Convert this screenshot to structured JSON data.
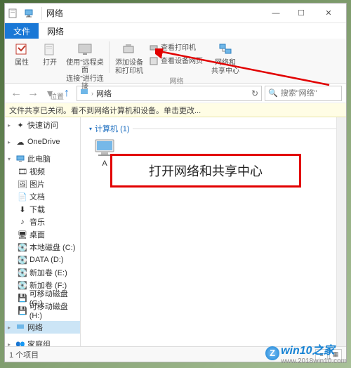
{
  "window": {
    "title": "网络",
    "controls": {
      "min": "—",
      "max": "☐",
      "close": "✕"
    }
  },
  "tabs": {
    "file": "文件",
    "network": "网络"
  },
  "ribbon": {
    "properties": "属性",
    "open": "打开",
    "remote_desc1": "使用\"远程桌面",
    "remote_desc2": "连接\"进行连接",
    "section_location": "位置",
    "add_devices_l1": "添加设备",
    "add_devices_l2": "和打印机",
    "view_printers": "查看打印机",
    "view_devices": "查看设备网页",
    "network_center_l1": "网络和",
    "network_center_l2": "共享中心",
    "section_network": "网络"
  },
  "address": {
    "root_icon": "net",
    "crumb": "网络",
    "search_placeholder": "搜索\"网络\""
  },
  "infobar": "文件共享已关闭。看不到网络计算机和设备。单击更改...",
  "nav": {
    "quick_access": "快速访问",
    "onedrive": "OneDrive",
    "this_pc": "此电脑",
    "videos": "视频",
    "pictures": "图片",
    "documents": "文档",
    "downloads": "下载",
    "music": "音乐",
    "desktop": "桌面",
    "disk_c": "本地磁盘 (C:)",
    "disk_d": "DATA (D:)",
    "disk_e": "新加卷 (E:)",
    "disk_f": "新加卷 (F:)",
    "disk_g": "可移动磁盘 (G:)",
    "disk_h": "可移动磁盘 (H:)",
    "network": "网络",
    "homegroup": "家庭组"
  },
  "content": {
    "group_header": "计算机 (1)",
    "computer_name": "A"
  },
  "callout": "打开网络和共享中心",
  "status": {
    "count": "1 个项目"
  },
  "watermark": {
    "brand": "win10之家",
    "url": "www.2018win10.com"
  }
}
